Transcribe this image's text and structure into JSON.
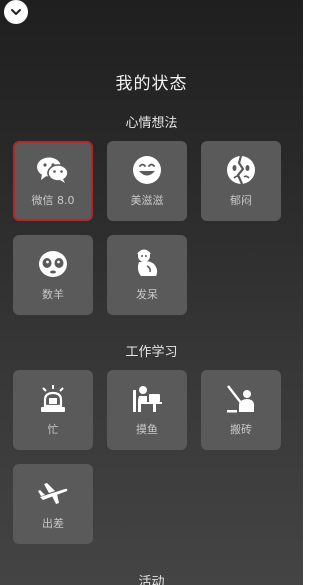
{
  "header": {
    "collapse_icon": "chevron-down-icon"
  },
  "title": "我的状态",
  "sections": [
    {
      "heading": "心情想法",
      "items": [
        {
          "label": "微信 8.0",
          "icon": "wechat-icon",
          "selected": true
        },
        {
          "label": "美滋滋",
          "icon": "smiley-icon"
        },
        {
          "label": "郁闷",
          "icon": "gloomy-face-icon"
        },
        {
          "label": "数羊",
          "icon": "sheep-icon"
        },
        {
          "label": "发呆",
          "icon": "daze-figure-icon"
        }
      ]
    },
    {
      "heading": "工作学习",
      "items": [
        {
          "label": "忙",
          "icon": "alarm-light-icon"
        },
        {
          "label": "摸鱼",
          "icon": "desk-person-icon"
        },
        {
          "label": "搬砖",
          "icon": "worker-icon"
        },
        {
          "label": "出差",
          "icon": "airplane-icon"
        }
      ]
    },
    {
      "heading": "活动"
    }
  ],
  "colors": {
    "selected_border": "#b3262a",
    "tile_bg": "#5a5a5a"
  }
}
